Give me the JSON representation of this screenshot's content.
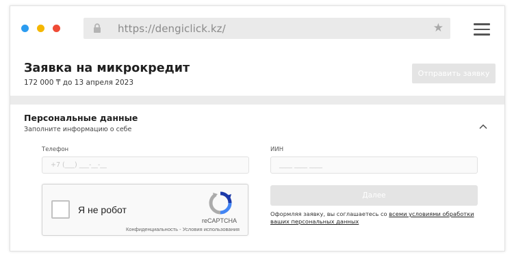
{
  "browser": {
    "url": "https://dengiclick.kz/",
    "icons": {
      "lock": "lock-icon",
      "bookmark": "star-icon",
      "menu": "hamburger-menu-icon"
    },
    "window_dots": [
      "#2c9cf0",
      "#f5b700",
      "#ef4b36"
    ]
  },
  "header": {
    "title": "Заявка на микрокредит",
    "subtitle": "172 000 ₸ до 13 апреля 2023",
    "submit_label": "Отправить заявку"
  },
  "section": {
    "title": "Персональные данные",
    "subtitle": "Заполните информацию о себе"
  },
  "form": {
    "phone": {
      "label": "Телефон",
      "placeholder": "+7 (___) ___-__-__"
    },
    "iin": {
      "label": "ИИН",
      "placeholder": "____ ____ ____"
    },
    "next_label": "Далее"
  },
  "recaptcha": {
    "label": "Я не робот",
    "brand": "reCAPTCHA",
    "privacy": "Конфиденциальность",
    "separator": " - ",
    "terms": "Условия использования"
  },
  "agreement": {
    "text": "Оформляя заявку, вы соглашаетесь со ",
    "link": "всеми условиями обработки ваших персональных данных"
  },
  "colors": {
    "accent_disabled": "#e4e4e4",
    "separator": "#ebebeb",
    "urlbar": "#eaeaea"
  }
}
